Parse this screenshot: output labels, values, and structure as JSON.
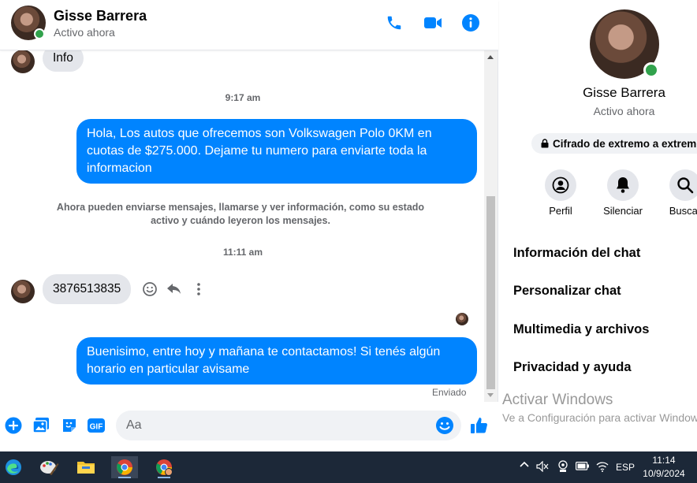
{
  "header": {
    "name": "Gisse Barrera",
    "status": "Activo ahora"
  },
  "messages": {
    "first_incoming": "Info",
    "time1": "9:17 am",
    "outgoing1": "Hola, Los autos que ofrecemos son Volkswagen Polo 0KM en cuotas de $275.000. Dejame tu numero para enviarte toda la informacion",
    "system_note": "Ahora pueden enviarse mensajes, llamarse y ver información, como su estado activo y cuándo leyeron los mensajes.",
    "time2": "11:11 am",
    "incoming_phone": "3876513835",
    "outgoing2": "Buenisimo, entre hoy y mañana te contactamos! Si tenés algún horario en particular avisame",
    "sent_status": "Enviado"
  },
  "composer": {
    "placeholder": "Aa"
  },
  "info_panel": {
    "name": "Gisse Barrera",
    "status": "Activo ahora",
    "e2e": "Cifrado de extremo a extremo",
    "actions": [
      "Perfil",
      "Silenciar",
      "Buscar"
    ],
    "rows": [
      "Información del chat",
      "Personalizar chat",
      "Multimedia y archivos",
      "Privacidad y ayuda"
    ]
  },
  "watermark": {
    "title": "Activar Windows",
    "subtitle": "Ve a Configuración para activar Windows."
  },
  "taskbar": {
    "lang": "ESP",
    "time": "11:14",
    "date": "10/9/2024"
  },
  "colors": {
    "accent": "#0084ff",
    "online": "#31a24c",
    "taskbar": "#1c2838"
  }
}
